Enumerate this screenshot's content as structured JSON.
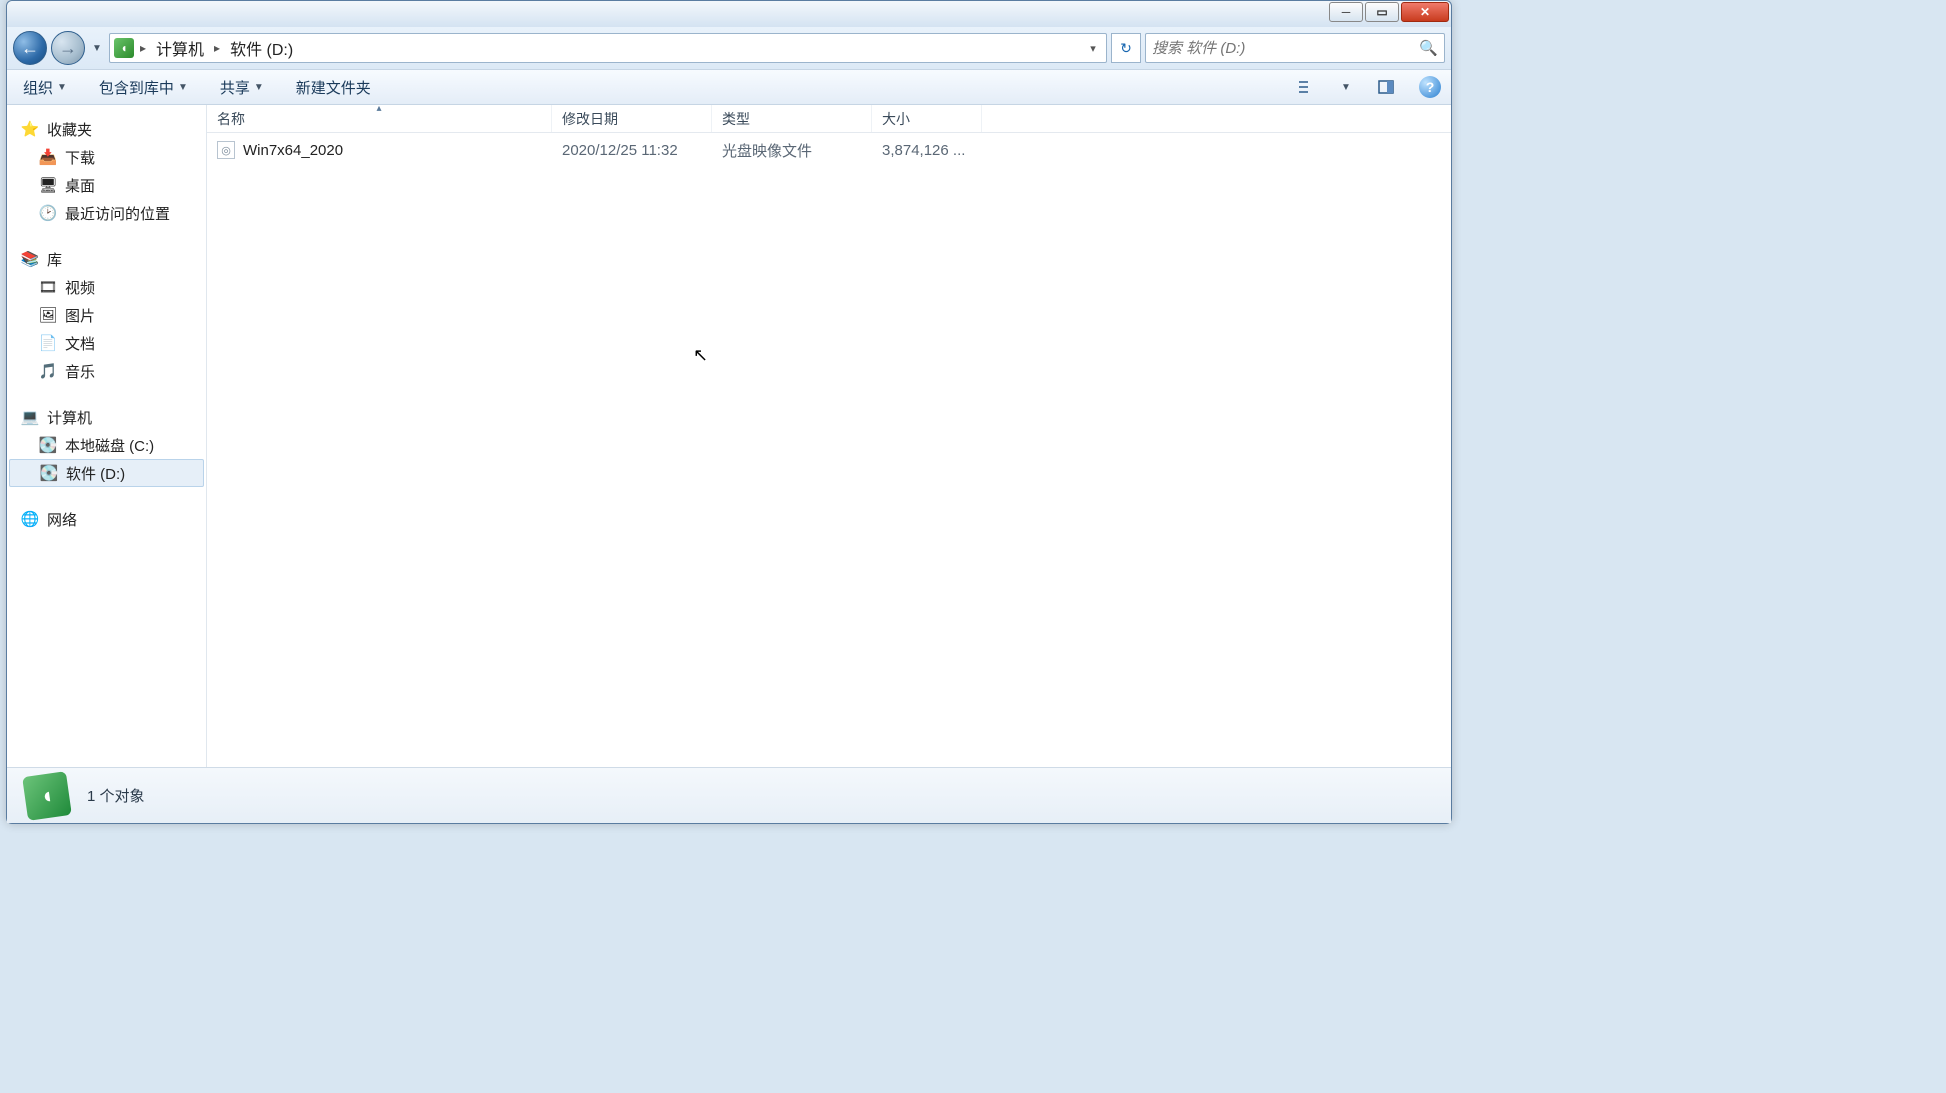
{
  "window": {
    "title": ""
  },
  "address": {
    "segments": [
      "计算机",
      "软件 (D:)"
    ]
  },
  "search": {
    "placeholder": "搜索 软件 (D:)"
  },
  "toolbar": {
    "organize": "组织",
    "include": "包含到库中",
    "share": "共享",
    "newfolder": "新建文件夹"
  },
  "sidebar": {
    "favorites": {
      "label": "收藏夹",
      "items": [
        "下载",
        "桌面",
        "最近访问的位置"
      ]
    },
    "libraries": {
      "label": "库",
      "items": [
        "视频",
        "图片",
        "文档",
        "音乐"
      ]
    },
    "computer": {
      "label": "计算机",
      "items": [
        "本地磁盘 (C:)",
        "软件 (D:)"
      ]
    },
    "network": {
      "label": "网络"
    }
  },
  "columns": {
    "name": "名称",
    "date": "修改日期",
    "type": "类型",
    "size": "大小"
  },
  "files": [
    {
      "name": "Win7x64_2020",
      "date": "2020/12/25 11:32",
      "type": "光盘映像文件",
      "size": "3,874,126 ..."
    }
  ],
  "status": {
    "text": "1 个对象"
  }
}
